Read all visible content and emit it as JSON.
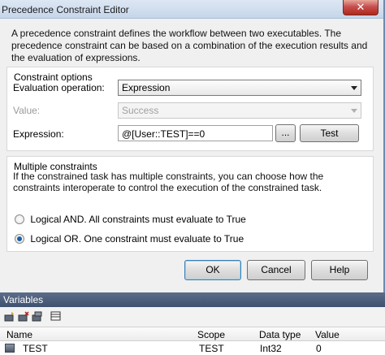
{
  "dialog": {
    "title": "Precedence Constraint Editor",
    "close_symbol": "✕",
    "description": "A precedence constraint defines the workflow between two executables. The precedence constraint can be based on a combination of the execution results and the evaluation of expressions."
  },
  "constraint_options": {
    "heading": "Constraint options",
    "evaluation_operation": {
      "label": "Evaluation operation:",
      "value": "Expression"
    },
    "value": {
      "label": "Value:",
      "value": "Success",
      "disabled": true
    },
    "expression": {
      "label": "Expression:",
      "value": "@[User::TEST]==0",
      "browse_label": "...",
      "test_label": "Test"
    }
  },
  "multiple_constraints": {
    "heading": "Multiple constraints",
    "help": "If the constrained task has multiple constraints, you can choose how the constraints interoperate to control the execution of the constrained task.",
    "options": [
      {
        "label": "Logical AND. All constraints must evaluate to True",
        "checked": false
      },
      {
        "label": "Logical OR. One constraint must evaluate to True",
        "checked": true
      }
    ]
  },
  "buttons": {
    "ok": "OK",
    "cancel": "Cancel",
    "help": "Help"
  },
  "variables": {
    "title": "Variables",
    "toolbar": [
      "add-variable-icon",
      "delete-variable-icon",
      "show-system-variables-icon",
      "choose-columns-icon"
    ],
    "columns": [
      "Name",
      "Scope",
      "Data type",
      "Value"
    ],
    "rows": [
      {
        "name": "TEST",
        "scope": "TEST",
        "data_type": "Int32",
        "value": "0"
      }
    ]
  }
}
